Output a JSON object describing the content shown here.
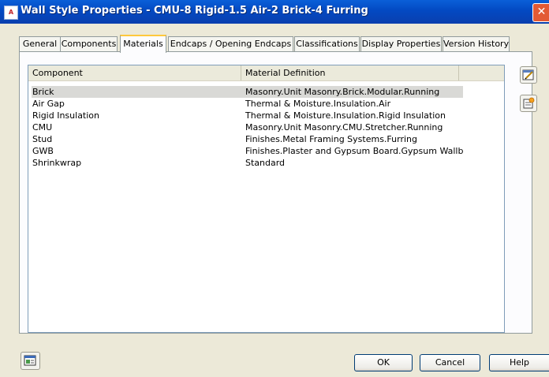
{
  "window": {
    "title": "Wall Style Properties - CMU-8 Rigid-1.5 Air-2 Brick-4 Furring",
    "app_icon_text": "A¹⁰",
    "close_glyph": "✕"
  },
  "tabs": [
    {
      "label": "General"
    },
    {
      "label": "Components"
    },
    {
      "label": "Materials",
      "active": true
    },
    {
      "label": "Endcaps / Opening Endcaps"
    },
    {
      "label": "Classifications"
    },
    {
      "label": "Display Properties"
    },
    {
      "label": "Version History"
    }
  ],
  "table": {
    "headers": [
      "Component",
      "Material Definition"
    ],
    "rows": [
      {
        "component": "Brick",
        "material": "Masonry.Unit Masonry.Brick.Modular.Running",
        "selected": true
      },
      {
        "component": "Air Gap",
        "material": "Thermal & Moisture.Insulation.Air"
      },
      {
        "component": "Rigid Insulation",
        "material": "Thermal & Moisture.Insulation.Rigid Insulation"
      },
      {
        "component": "CMU",
        "material": "Masonry.Unit Masonry.CMU.Stretcher.Running"
      },
      {
        "component": "Stud",
        "material": "Finishes.Metal Framing Systems.Furring"
      },
      {
        "component": "GWB",
        "material": "Finishes.Plaster and Gypsum Board.Gypsum Wallb..."
      },
      {
        "component": "Shrinkwrap",
        "material": "Standard"
      }
    ]
  },
  "side_buttons": [
    {
      "icon": "edit-material-icon"
    },
    {
      "icon": "add-material-icon"
    }
  ],
  "footer": {
    "ok_label": "OK",
    "cancel_label": "Cancel",
    "help_label": "Help",
    "left_icon": "style-browser-icon"
  },
  "colors": {
    "title_bar": "#0349c2",
    "active_tab_accent": "#ffc83c",
    "selection": "#d9d9d6",
    "close_button": "#e35a35"
  }
}
